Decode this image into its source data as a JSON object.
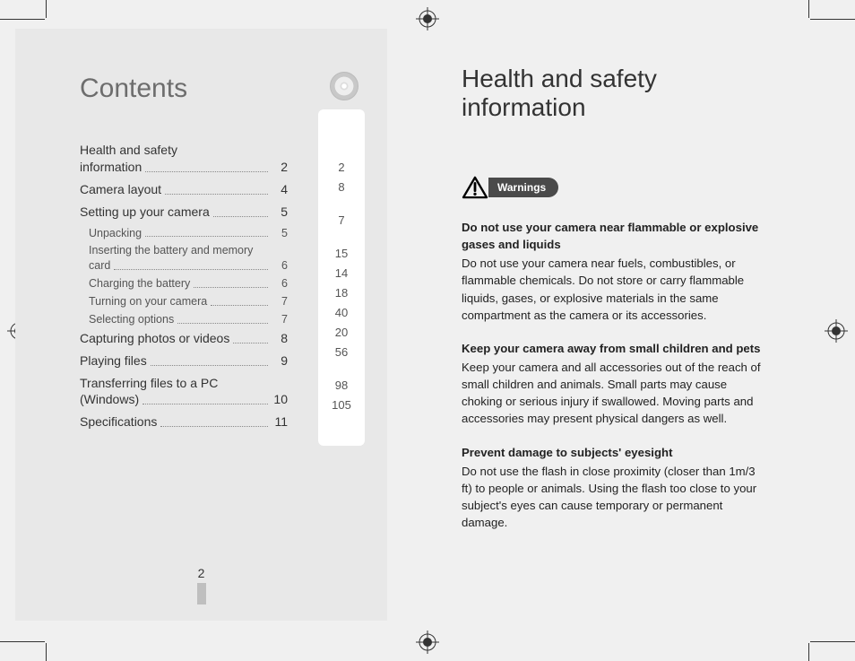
{
  "left": {
    "title": "Contents",
    "toc": [
      {
        "label": "Health and safety information",
        "page": "2",
        "sub": false,
        "wrap": true
      },
      {
        "label": "Camera layout",
        "page": "4",
        "sub": false
      },
      {
        "label": "Setting up your camera",
        "page": "5",
        "sub": false
      },
      {
        "label": "Unpacking",
        "page": "5",
        "sub": true
      },
      {
        "label": "Inserting the battery and memory card",
        "page": "6",
        "sub": true,
        "wrap": true
      },
      {
        "label": "Charging the battery",
        "page": "6",
        "sub": true
      },
      {
        "label": "Turning on your camera",
        "page": "7",
        "sub": true
      },
      {
        "label": "Selecting options",
        "page": "7",
        "sub": true
      },
      {
        "label": "Capturing photos or videos",
        "page": "8",
        "sub": false
      },
      {
        "label": "Playing files",
        "page": "9",
        "sub": false
      },
      {
        "label": "Transferring files to a PC (Windows)",
        "page": "10",
        "sub": false,
        "wrap": true
      },
      {
        "label": "Specifications",
        "page": "11",
        "sub": false
      }
    ],
    "side_numbers": [
      "2",
      "8",
      "",
      "7",
      "",
      "15",
      "14",
      "18",
      "40",
      "20",
      "56",
      "",
      "98",
      "105"
    ],
    "page_number": "2"
  },
  "right": {
    "title": "Health and safety information",
    "badge": "Warnings",
    "sections": [
      {
        "heading": "Do not use your camera near flammable or explosive gases and liquids",
        "body": "Do not use your camera near fuels, combustibles, or flammable chemicals. Do not store or carry flammable liquids, gases, or explosive materials in the same compartment as the camera or its accessories."
      },
      {
        "heading": "Keep your camera away from small children and pets",
        "body": "Keep your camera and all accessories out of the reach of small children and animals. Small parts may cause choking or serious injury if swallowed. Moving parts and accessories may present physical dangers as well."
      },
      {
        "heading": "Prevent damage to subjects' eyesight",
        "body": "Do not use the flash in close proximity (closer than 1m/3 ft) to people or animals. Using the flash too close to your subject's eyes can cause temporary or permanent damage."
      }
    ]
  }
}
